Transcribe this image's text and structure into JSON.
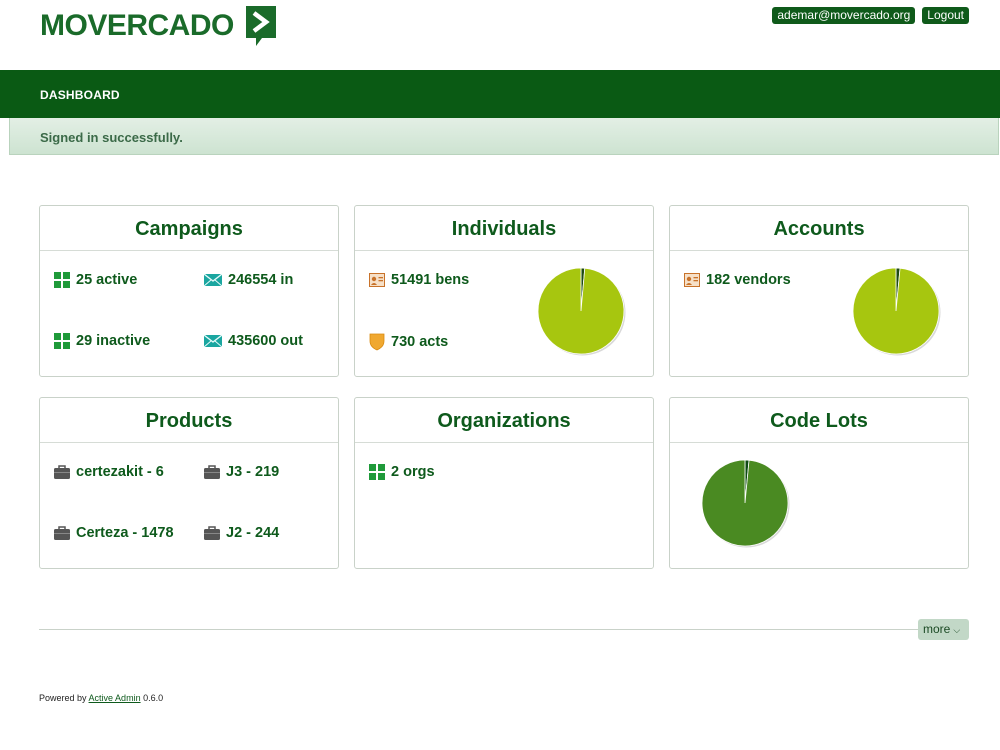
{
  "header": {
    "logo_text": "MOVERCADO",
    "user_email": "ademar@movercado.org",
    "logout_label": "Logout"
  },
  "nav": {
    "dashboard_label": "DASHBOARD"
  },
  "flash": {
    "message": "Signed in successfully."
  },
  "panels": {
    "campaigns": {
      "title": "Campaigns",
      "active": "25 active",
      "inactive": "29 inactive",
      "in": "246554 in",
      "out": "435600 out"
    },
    "individuals": {
      "title": "Individuals",
      "bens": "51491 bens",
      "acts": "730 acts",
      "pie": {
        "slices": [
          51491,
          730
        ],
        "colors": [
          "#a7c60f",
          "#1f4a12"
        ]
      }
    },
    "accounts": {
      "title": "Accounts",
      "vendors": "182 vendors",
      "pie": {
        "slices": [
          98.5,
          1.5
        ],
        "colors": [
          "#a7c60f",
          "#1f4a12"
        ]
      }
    },
    "products": {
      "title": "Products",
      "items": [
        "certezakit - 6",
        "J3 - 219",
        "Certeza - 1478",
        "J2 - 244"
      ]
    },
    "organizations": {
      "title": "Organizations",
      "orgs": "2 orgs"
    },
    "code_lots": {
      "title": "Code Lots",
      "pie": {
        "slices": [
          98.5,
          1.5
        ],
        "colors": [
          "#4a8a22",
          "#0d4a12"
        ]
      }
    }
  },
  "more_label": "more",
  "footer": {
    "powered_by": "Powered by",
    "link_text": "Active Admin",
    "version": "0.6.0"
  },
  "colors": {
    "brand_green": "#0a5a14",
    "text_green": "#0e5a1c",
    "pie_lime": "#a7c60f",
    "pie_green": "#4a8a22"
  }
}
